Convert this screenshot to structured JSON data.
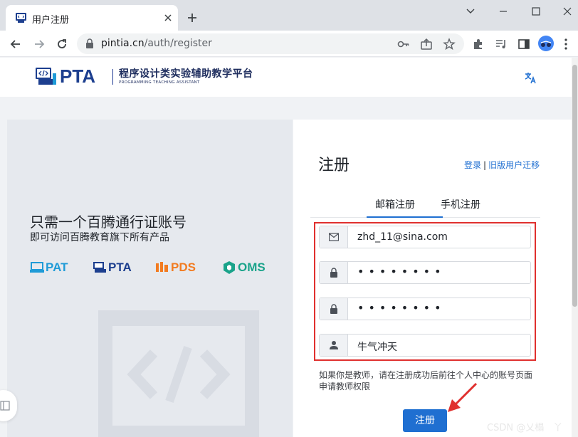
{
  "browser": {
    "tab_title": "用户注册",
    "url_host": "pintia.cn",
    "url_path": "/auth/register"
  },
  "header": {
    "logo_text": "PTA",
    "logo_cn": "程序设计类实验辅助教学平台",
    "logo_en": "PROGRAMMING TEACHING ASSISTANT"
  },
  "promo": {
    "title": "只需一个百腾通行证账号",
    "subtitle": "即可访问百腾教育旗下所有产品",
    "brands": [
      {
        "label": "PAT",
        "color": "#1f9bd7"
      },
      {
        "label": "PTA",
        "color": "#1d3f8f"
      },
      {
        "label": "PDS",
        "color": "#f27b20"
      },
      {
        "label": "OMS",
        "color": "#1aa38a"
      }
    ]
  },
  "form": {
    "title": "注册",
    "login_link": "登录",
    "separator": "|",
    "migrate_link": "旧版用户迁移",
    "tabs": [
      {
        "label": "邮箱注册",
        "active": true
      },
      {
        "label": "手机注册",
        "active": false
      }
    ],
    "email_value": "zhd_11@sina.com",
    "password_value": "••••••••",
    "confirm_password_value": "••••••••",
    "nickname_value": "牛气冲天",
    "teacher_note": "如果你是教师，请在注册成功后前往个人中心的账号页面申请教师权限",
    "submit_label": "注册"
  },
  "watermark": "CSDN @乂榻　丫",
  "colors": {
    "accent": "#1f6fd1",
    "highlight": "#e0302e"
  }
}
